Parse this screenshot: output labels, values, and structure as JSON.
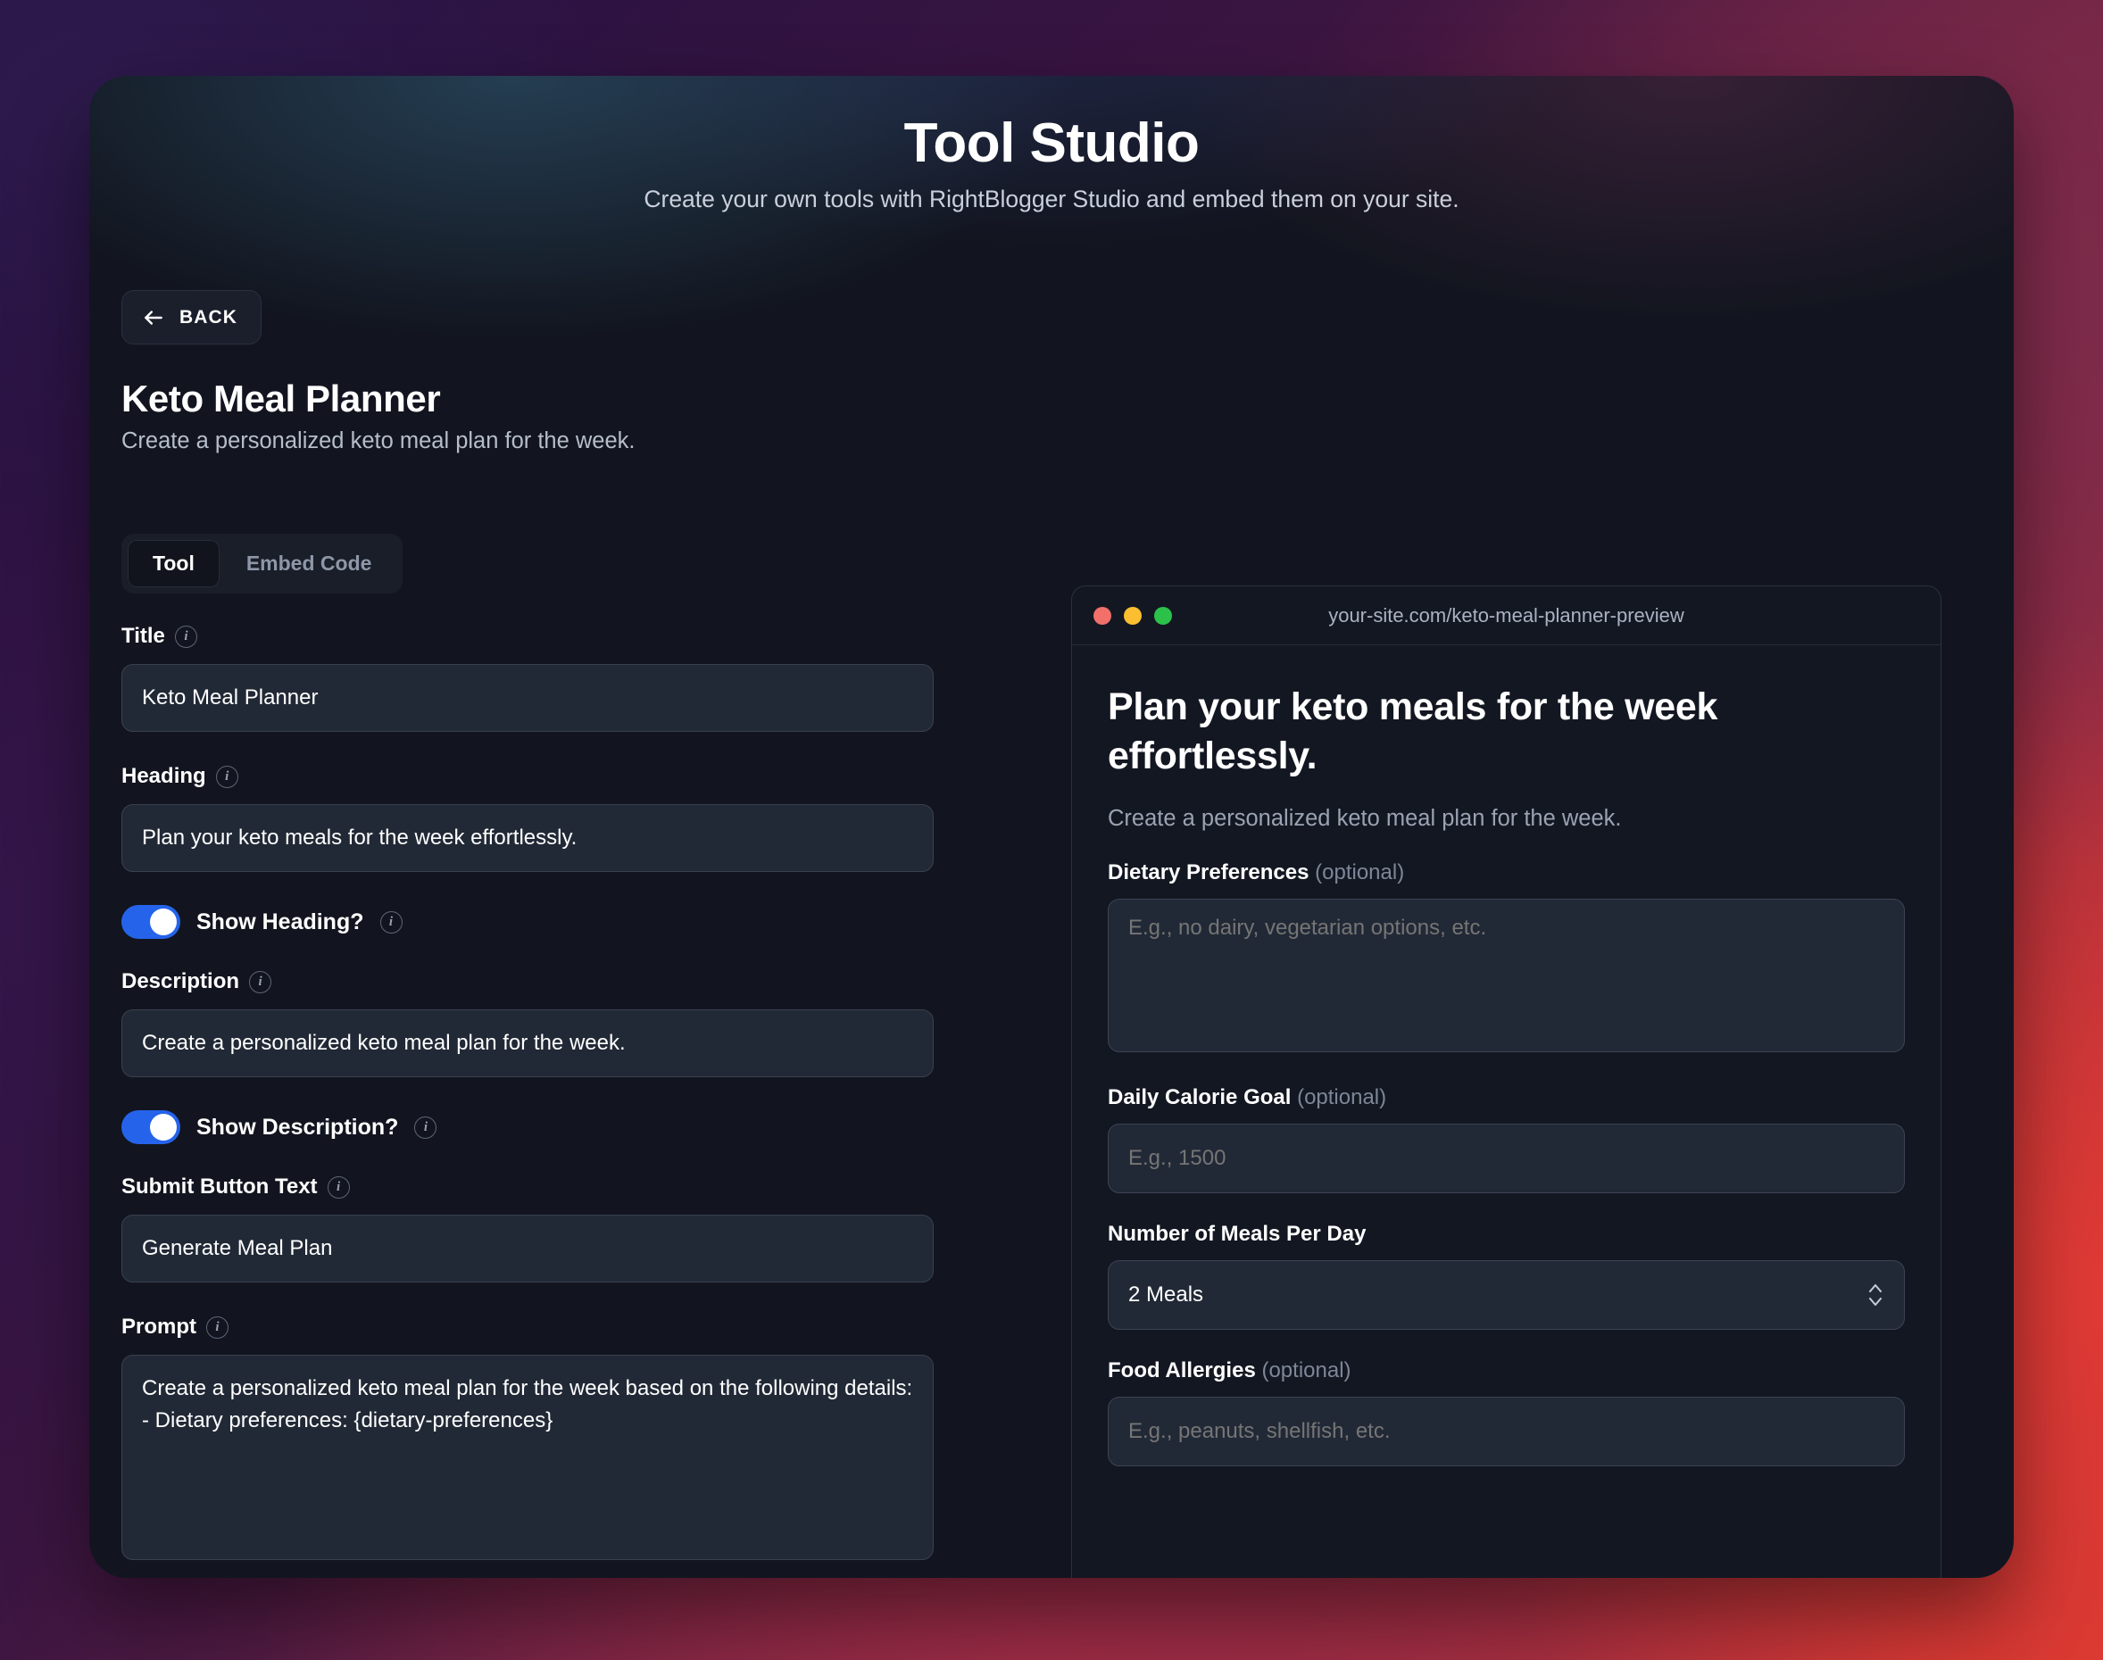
{
  "hero": {
    "title": "Tool Studio",
    "subtitle": "Create your own tools with RightBlogger Studio and embed them on your site."
  },
  "back_button": {
    "label": "BACK",
    "icon": "arrow-left-icon"
  },
  "tool": {
    "name": "Keto Meal Planner",
    "description": "Create a personalized keto meal plan for the week."
  },
  "tabs": [
    {
      "label": "Tool",
      "active": true
    },
    {
      "label": "Embed Code",
      "active": false
    }
  ],
  "editor": {
    "title_field": {
      "label": "Title",
      "value": "Keto Meal Planner",
      "info_icon": "info-icon"
    },
    "heading_field": {
      "label": "Heading",
      "value": "Plan your keto meals for the week effortlessly.",
      "info_icon": "info-icon"
    },
    "show_heading_toggle": {
      "label": "Show Heading?",
      "checked": true,
      "info_icon": "info-icon"
    },
    "description_field": {
      "label": "Description",
      "value": "Create a personalized keto meal plan for the week.",
      "info_icon": "info-icon"
    },
    "show_description_toggle": {
      "label": "Show Description?",
      "checked": true,
      "info_icon": "info-icon"
    },
    "submit_button_text_field": {
      "label": "Submit Button Text",
      "value": "Generate Meal Plan",
      "info_icon": "info-icon"
    },
    "prompt_field": {
      "label": "Prompt",
      "value": "Create a personalized keto meal plan for the week based on the following details:\n- Dietary preferences: {dietary-preferences}",
      "info_icon": "info-icon"
    }
  },
  "preview": {
    "url": "your-site.com/keto-meal-planner-preview",
    "window_dots": [
      "red",
      "yellow",
      "green"
    ],
    "heading": "Plan your keto meals for the week effortlessly.",
    "description": "Create a personalized keto meal plan for the week.",
    "fields": {
      "dietary_preferences": {
        "label": "Dietary Preferences",
        "optional": "(optional)",
        "placeholder": "E.g., no dairy, vegetarian options, etc."
      },
      "daily_calorie_goal": {
        "label": "Daily Calorie Goal",
        "optional": "(optional)",
        "placeholder": "E.g., 1500"
      },
      "meals_per_day": {
        "label": "Number of Meals Per Day",
        "value": "2 Meals",
        "icon": "chevron-up-down-icon"
      },
      "food_allergies": {
        "label": "Food Allergies",
        "optional": "(optional)",
        "placeholder": "E.g., peanuts, shellfish, etc."
      }
    }
  },
  "colors": {
    "accent_blue": "#2563eb",
    "card_bg": "#12151f",
    "input_bg": "#222936",
    "dot_red": "#f1706a",
    "dot_yellow": "#fbbe30",
    "dot_green": "#2cc14a"
  }
}
